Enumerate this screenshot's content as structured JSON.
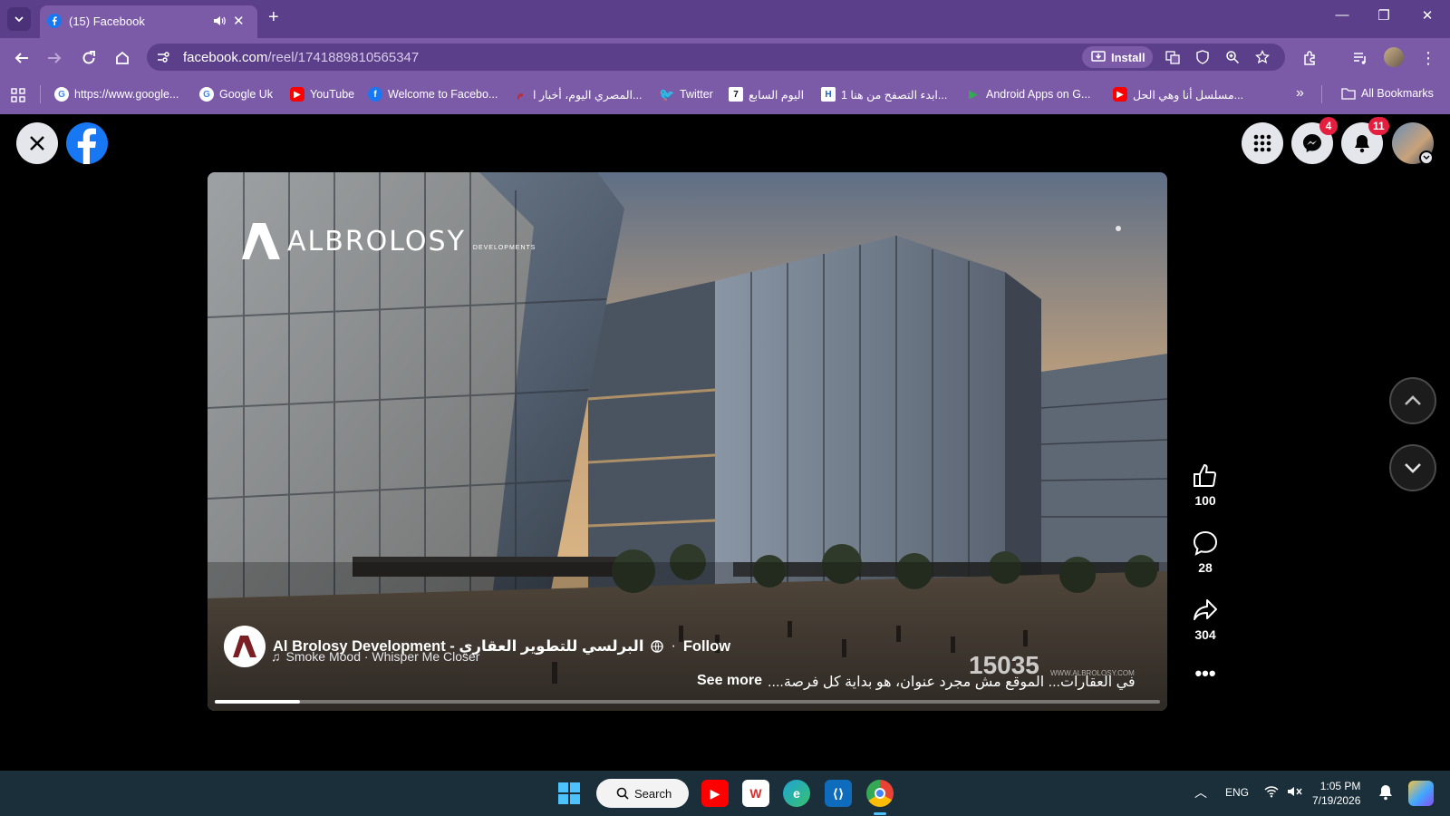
{
  "browser": {
    "tab_title": "(15) Facebook",
    "url_domain": "facebook.com",
    "url_path": "/reel/1741889810565347",
    "install_label": "Install",
    "bookmarks": [
      {
        "label": "https://www.google...",
        "icon": "google-icon"
      },
      {
        "label": "Google Uk",
        "icon": "google-icon"
      },
      {
        "label": "YouTube",
        "icon": "youtube-icon"
      },
      {
        "label": "Welcome to Facebo...",
        "icon": "facebook-icon"
      },
      {
        "label": "المصري اليوم، أخبار ا...",
        "icon": "almasry-icon"
      },
      {
        "label": "Twitter",
        "icon": "twitter-icon"
      },
      {
        "label": "اليوم السابع",
        "icon": "youm7-icon"
      },
      {
        "label": "ابدء التصفح من هنا 1...",
        "icon": "hq-icon"
      },
      {
        "label": "Android Apps on G...",
        "icon": "play-store-icon"
      },
      {
        "label": "مسلسل أنا وهي الحل...",
        "icon": "youtube-icon"
      }
    ],
    "all_bookmarks_label": "All Bookmarks"
  },
  "facebook": {
    "messenger_badge": "4",
    "notifications_badge": "11"
  },
  "reel": {
    "brand_name": "ALBROLOSY",
    "brand_sub": "DEVELOPMENTS",
    "number_watermark": "15035",
    "site_watermark": "WWW.ALBROLOSY.COM",
    "author": "Al Brolosy Development - البرلسي للتطوير العقاري",
    "separator": "·",
    "follow_label": "Follow",
    "audio": "Smoke Mood · Whisper Me Closer",
    "caption": "في العقارات... الموقع مش مجرد عنوان، هو بداية كل فرصة....",
    "see_more": "See more",
    "progress": 0.09,
    "likes": "100",
    "comments": "28",
    "shares": "304"
  },
  "taskbar": {
    "search_label": "Search",
    "language": "ENG",
    "time": "1:05 PM",
    "date": "7/19/2026"
  },
  "colors": {
    "chrome_dark": "#5b3f8a",
    "chrome_light": "#7b5aa8",
    "facebook_blue": "#1877f2",
    "badge_red": "#e41e3f",
    "taskbar": "#1b2f3a"
  }
}
